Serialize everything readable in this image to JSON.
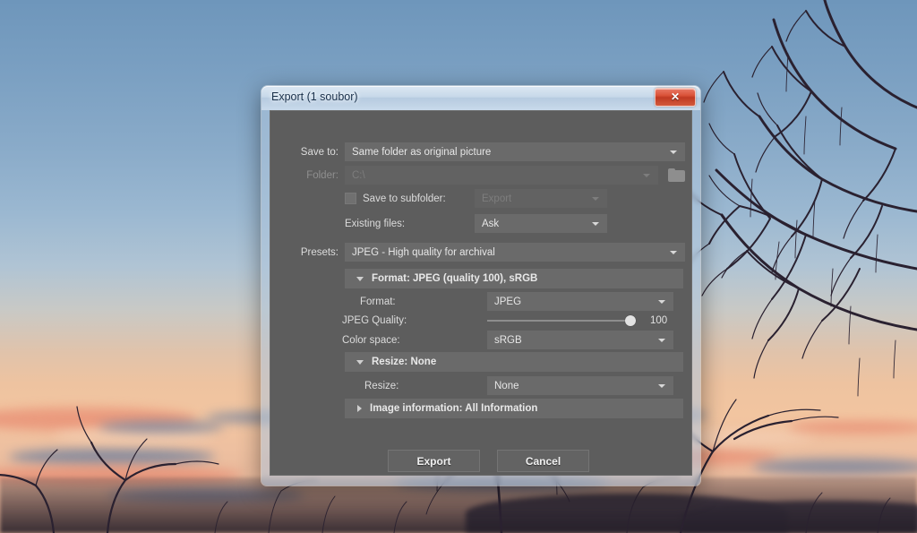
{
  "window": {
    "title": "Export (1 soubor)",
    "close_label": "✕",
    "close_icon": "close-icon"
  },
  "form": {
    "save_to": {
      "label": "Save to:",
      "value": "Same folder as original picture"
    },
    "folder": {
      "label": "Folder:",
      "value": "C:\\",
      "browse_icon": "folder-icon"
    },
    "save_to_subfolder": {
      "label": "Save to subfolder:",
      "checked": false,
      "value": "Export"
    },
    "existing_files": {
      "label": "Existing files:",
      "value": "Ask"
    },
    "presets": {
      "label": "Presets:",
      "value": "JPEG - High quality for archival"
    }
  },
  "sections": [
    {
      "name": "format-section",
      "header": "Format: JPEG (quality 100), sRGB",
      "expanded": true,
      "fields": {
        "format": {
          "label": "Format:",
          "value": "JPEG"
        },
        "jpeg_quality": {
          "label": "JPEG Quality:",
          "value": 100,
          "min": 0,
          "max": 100
        },
        "color_space": {
          "label": "Color space:",
          "value": "sRGB"
        }
      }
    },
    {
      "name": "resize-section",
      "header": "Resize: None",
      "expanded": true,
      "fields": {
        "resize": {
          "label": "Resize:",
          "value": "None"
        }
      }
    },
    {
      "name": "image-information-section",
      "header": "Image information: All Information",
      "expanded": false
    }
  ],
  "footer": {
    "export_label": "Export",
    "cancel_label": "Cancel"
  },
  "colors": {
    "dialog_bg": "#5d5d5d",
    "field_bg": "#6a6a6a",
    "section_bg": "#6a6a6a",
    "close_red": "#c03a22",
    "title_text": "#19304a"
  }
}
